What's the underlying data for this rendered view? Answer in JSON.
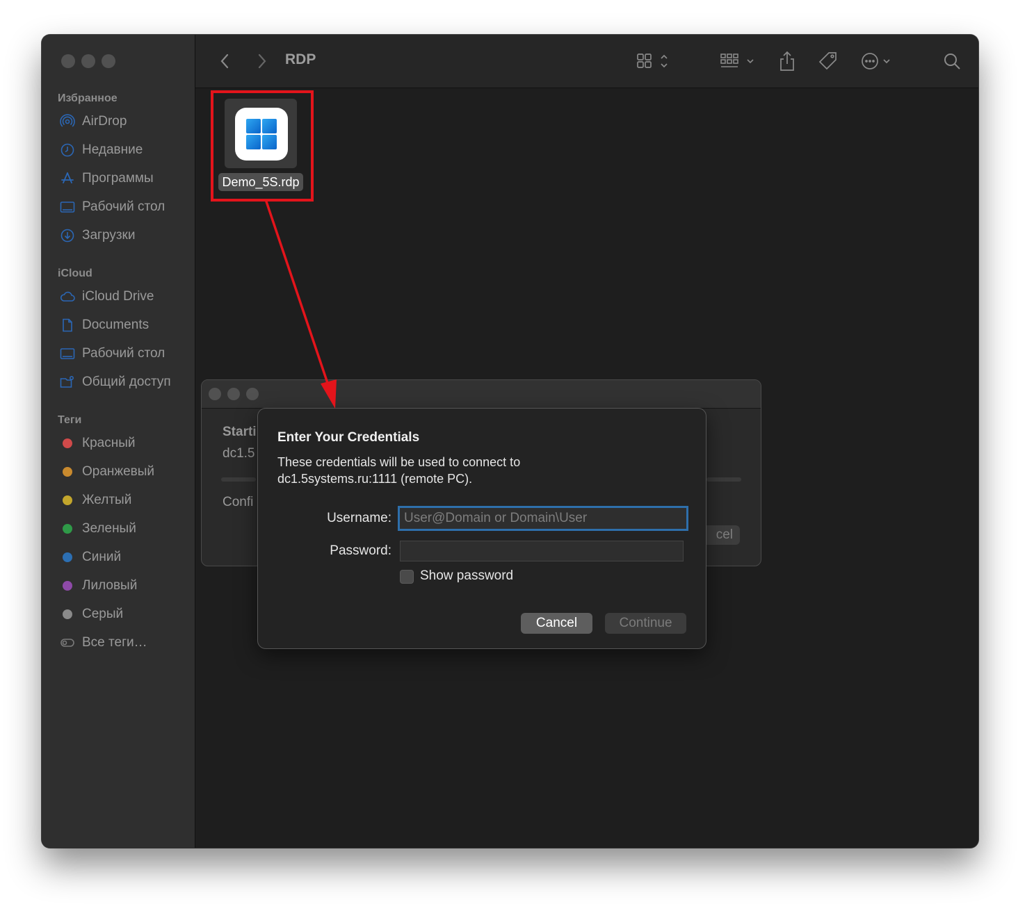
{
  "window": {
    "title": "RDP"
  },
  "sidebar": {
    "sections": [
      {
        "label": "Избранное",
        "items": [
          {
            "label": "AirDrop",
            "icon": "airdrop-icon"
          },
          {
            "label": "Недавние",
            "icon": "clock-icon"
          },
          {
            "label": "Программы",
            "icon": "apps-icon"
          },
          {
            "label": "Рабочий стол",
            "icon": "desktop-icon"
          },
          {
            "label": "Загрузки",
            "icon": "download-icon"
          }
        ]
      },
      {
        "label": "iCloud",
        "items": [
          {
            "label": "iCloud Drive",
            "icon": "cloud-icon"
          },
          {
            "label": "Documents",
            "icon": "document-icon"
          },
          {
            "label": "Рабочий стол",
            "icon": "desktop-icon"
          },
          {
            "label": "Общий доступ",
            "icon": "shared-folder-icon"
          }
        ]
      },
      {
        "label": "Теги",
        "items": [
          {
            "label": "Красный",
            "color": "#d04a4a"
          },
          {
            "label": "Оранжевый",
            "color": "#c98a2e"
          },
          {
            "label": "Желтый",
            "color": "#c3a62c"
          },
          {
            "label": "Зеленый",
            "color": "#2f9a48"
          },
          {
            "label": "Синий",
            "color": "#2c6fb3"
          },
          {
            "label": "Лиловый",
            "color": "#8e4aa8"
          },
          {
            "label": "Серый",
            "color": "#8a8a8a"
          },
          {
            "label": "Все теги…",
            "icon": "all-tags-icon"
          }
        ]
      }
    ]
  },
  "file": {
    "name": "Demo_5S.rdp",
    "icon": "windows-logo-icon"
  },
  "back_dialog": {
    "line1": "Starti",
    "line2": "dc1.5",
    "line3": "Confi",
    "button": "cel"
  },
  "credentials": {
    "title": "Enter Your Credentials",
    "desc_line1": "These credentials will be used to connect to",
    "desc_line2": "dc1.5systems.ru:1111 (remote PC).",
    "username_label": "Username:",
    "username_placeholder": "User@Domain or Domain\\User",
    "username_value": "",
    "password_label": "Password:",
    "password_value": "",
    "show_password_label": "Show password",
    "show_password_checked": false,
    "cancel_label": "Cancel",
    "continue_label": "Continue"
  },
  "colors": {
    "highlight": "#e3141b",
    "focus_ring": "#2e6fab"
  }
}
